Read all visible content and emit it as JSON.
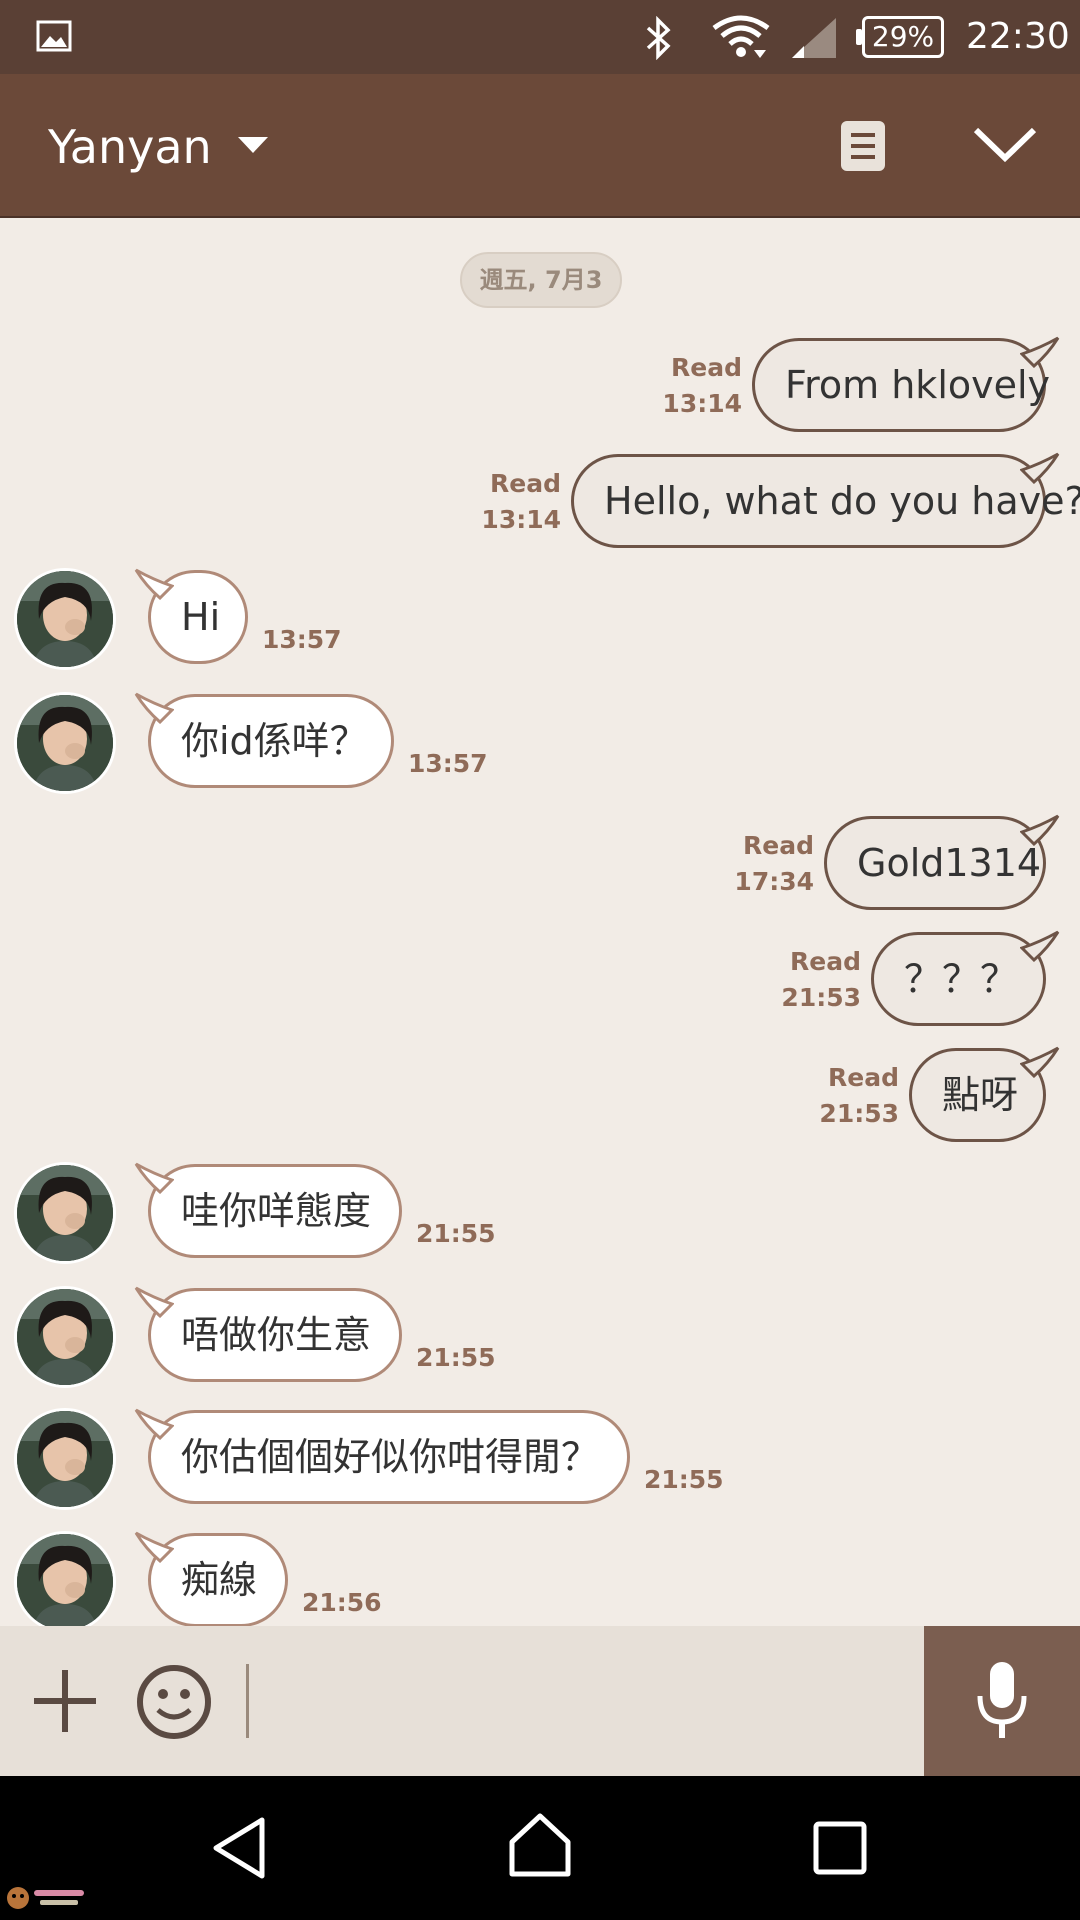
{
  "status_bar": {
    "battery": "29%",
    "time": "22:30",
    "icons": [
      "gallery-icon",
      "bluetooth-icon",
      "wifi-icon",
      "signal-icon",
      "battery-icon"
    ]
  },
  "header": {
    "contact_name": "Yanyan",
    "icons": [
      "dropdown-icon",
      "notes-icon",
      "collapse-icon"
    ]
  },
  "date_divider": "週五, 7月3",
  "messages": [
    {
      "direction": "out",
      "text": "From hklovely",
      "status": "Read",
      "time": "13:14"
    },
    {
      "direction": "out",
      "text": "Hello, what do you have?",
      "status": "Read",
      "time": "13:14"
    },
    {
      "direction": "in",
      "text": "Hi",
      "time": "13:57"
    },
    {
      "direction": "in",
      "text": "你id係咩？",
      "time": "13:57"
    },
    {
      "direction": "out",
      "text": "Gold1314",
      "status": "Read",
      "time": "17:34"
    },
    {
      "direction": "out",
      "text": "？？？",
      "status": "Read",
      "time": "21:53"
    },
    {
      "direction": "out",
      "text": "點呀",
      "status": "Read",
      "time": "21:53"
    },
    {
      "direction": "in",
      "text": "哇你咩態度",
      "time": "21:55"
    },
    {
      "direction": "in",
      "text": "唔做你生意",
      "time": "21:55"
    },
    {
      "direction": "in",
      "text": "你估個個好似你咁得閒？",
      "time": "21:55"
    },
    {
      "direction": "in",
      "text": "痴線",
      "time": "21:56"
    }
  ],
  "input_bar": {
    "text_value": "",
    "icons": [
      "add-icon",
      "emoji-icon",
      "microphone-icon"
    ]
  },
  "nav_bar": {
    "icons": [
      "back-icon",
      "home-icon",
      "recent-apps-icon"
    ]
  },
  "colors": {
    "header": "#6b4939",
    "status_bar": "#5a4035",
    "chat_background": "#f2ece6",
    "meta_text": "#8f6b58"
  }
}
